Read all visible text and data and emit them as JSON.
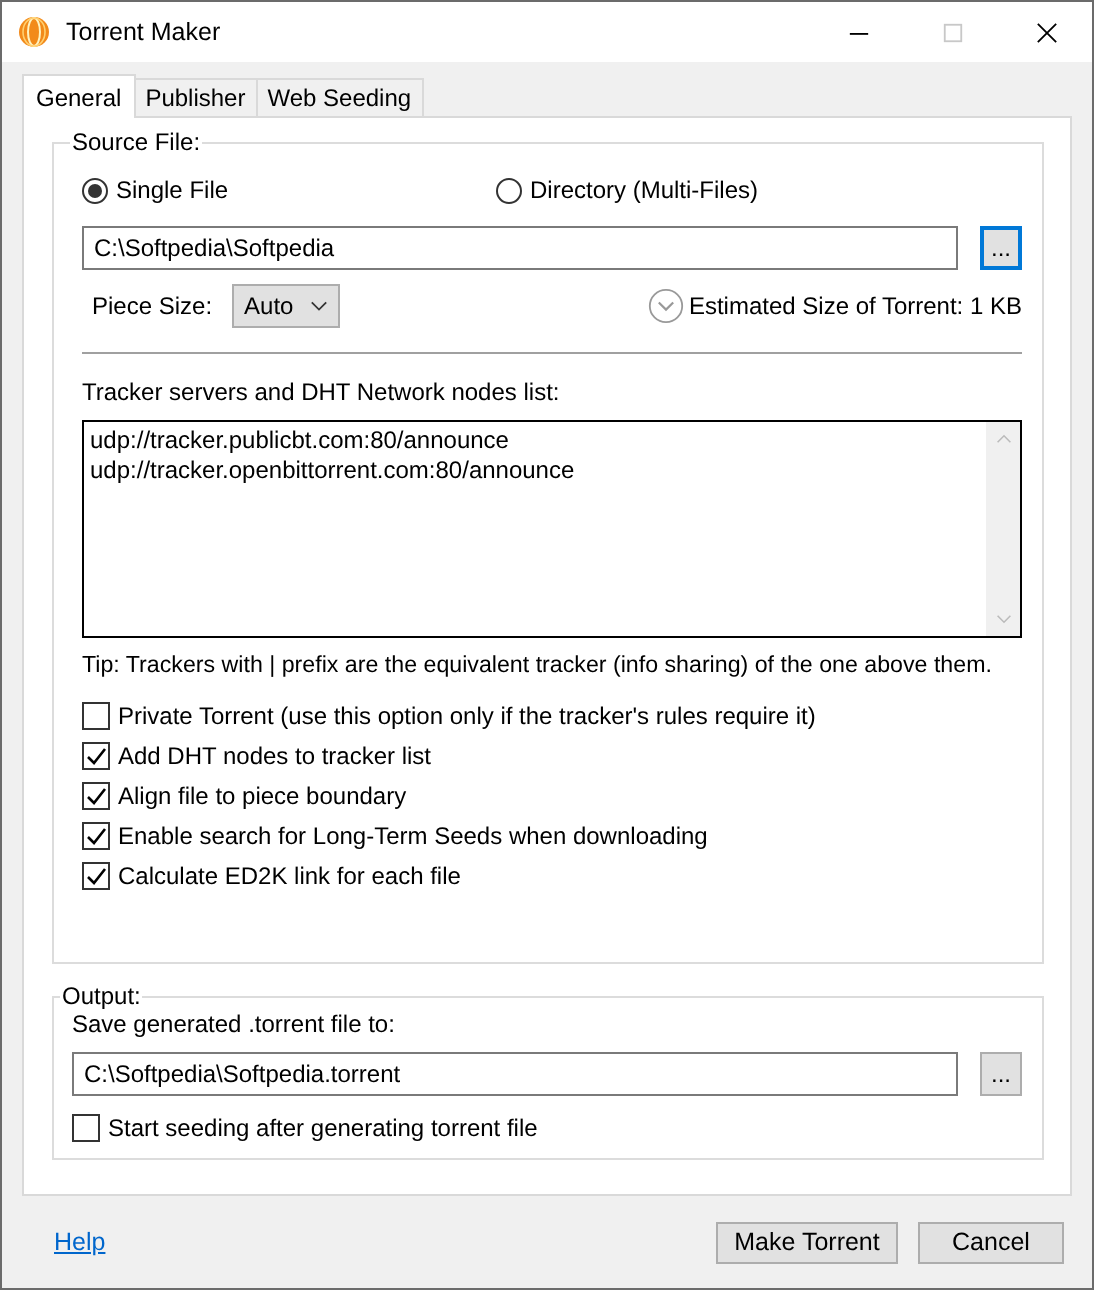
{
  "window": {
    "title": "Torrent Maker"
  },
  "tabs": [
    {
      "label": "General",
      "selected": true
    },
    {
      "label": "Publisher",
      "selected": false
    },
    {
      "label": "Web Seeding",
      "selected": false
    }
  ],
  "source": {
    "legend": "Source File:",
    "options": [
      {
        "label": "Single File",
        "selected": true
      },
      {
        "label": "Directory (Multi-Files)",
        "selected": false
      }
    ],
    "path": "C:\\Softpedia\\Softpedia",
    "browse": "...",
    "piece_size_label": "Piece Size:",
    "piece_size": "Auto",
    "estimated": "Estimated Size of Torrent: 1 KB",
    "trackers_label": "Tracker servers and DHT Network nodes list:",
    "trackers": [
      "udp://tracker.publicbt.com:80/announce",
      "udp://tracker.openbittorrent.com:80/announce"
    ],
    "tip": "Tip: Trackers with | prefix are the equivalent tracker (info sharing) of the one above them.",
    "checkboxes": [
      {
        "label": "Private Torrent (use this option only if the tracker's rules require it)",
        "checked": false
      },
      {
        "label": "Add DHT nodes to tracker list",
        "checked": true
      },
      {
        "label": "Align file to piece boundary",
        "checked": true
      },
      {
        "label": "Enable search for Long-Term Seeds when downloading",
        "checked": true
      },
      {
        "label": "Calculate ED2K link for each file",
        "checked": true
      }
    ]
  },
  "output": {
    "legend": "Output:",
    "save_label": "Save generated .torrent file to:",
    "path": "C:\\Softpedia\\Softpedia.torrent",
    "browse": "...",
    "checkbox": {
      "label": "Start seeding after generating torrent file",
      "checked": false
    }
  },
  "footer": {
    "help": "Help",
    "buttons": [
      "Make Torrent",
      "Cancel"
    ]
  }
}
